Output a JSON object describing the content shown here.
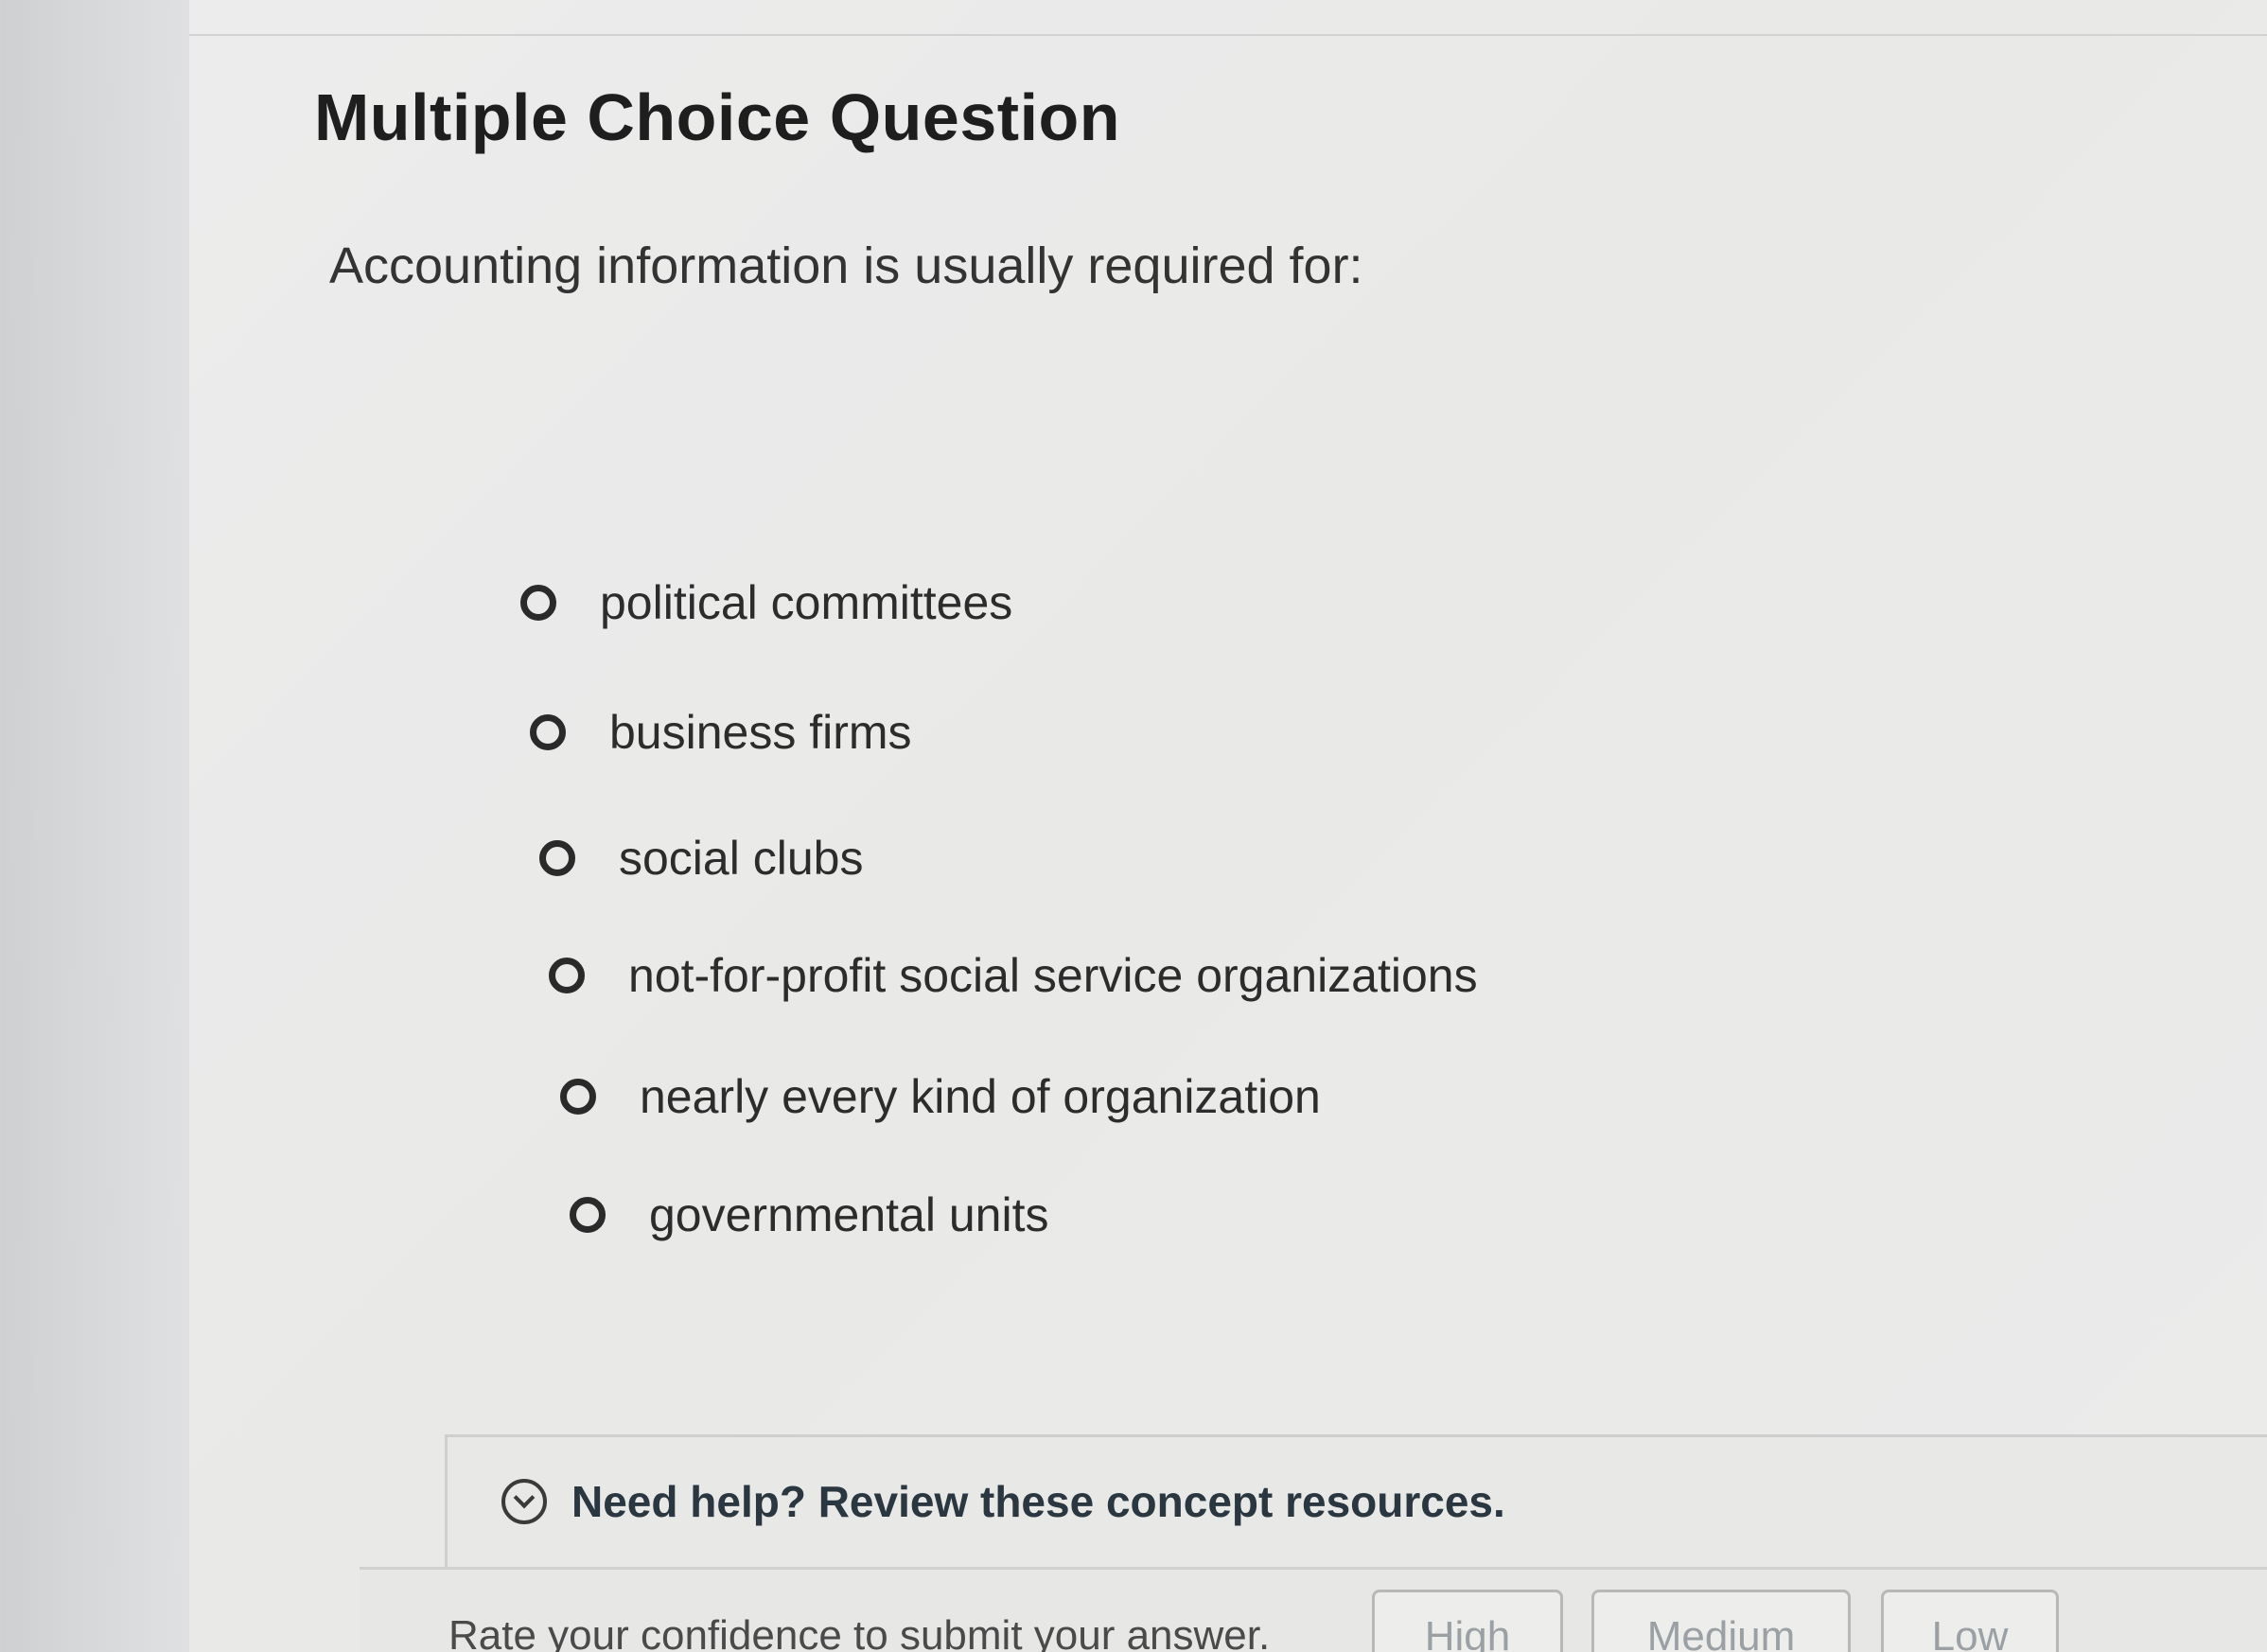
{
  "question": {
    "heading": "Multiple Choice Question",
    "prompt": "Accounting information is usually required for:",
    "options": [
      {
        "label": "political committees"
      },
      {
        "label": "business firms"
      },
      {
        "label": "social clubs"
      },
      {
        "label": "not-for-profit social service organizations"
      },
      {
        "label": "nearly every kind of organization"
      },
      {
        "label": "governmental units"
      }
    ]
  },
  "help": {
    "text": "Need help? Review these concept resources."
  },
  "confidence": {
    "label": "Rate your confidence to submit your answer.",
    "high": "High",
    "medium": "Medium",
    "low": "Low"
  }
}
